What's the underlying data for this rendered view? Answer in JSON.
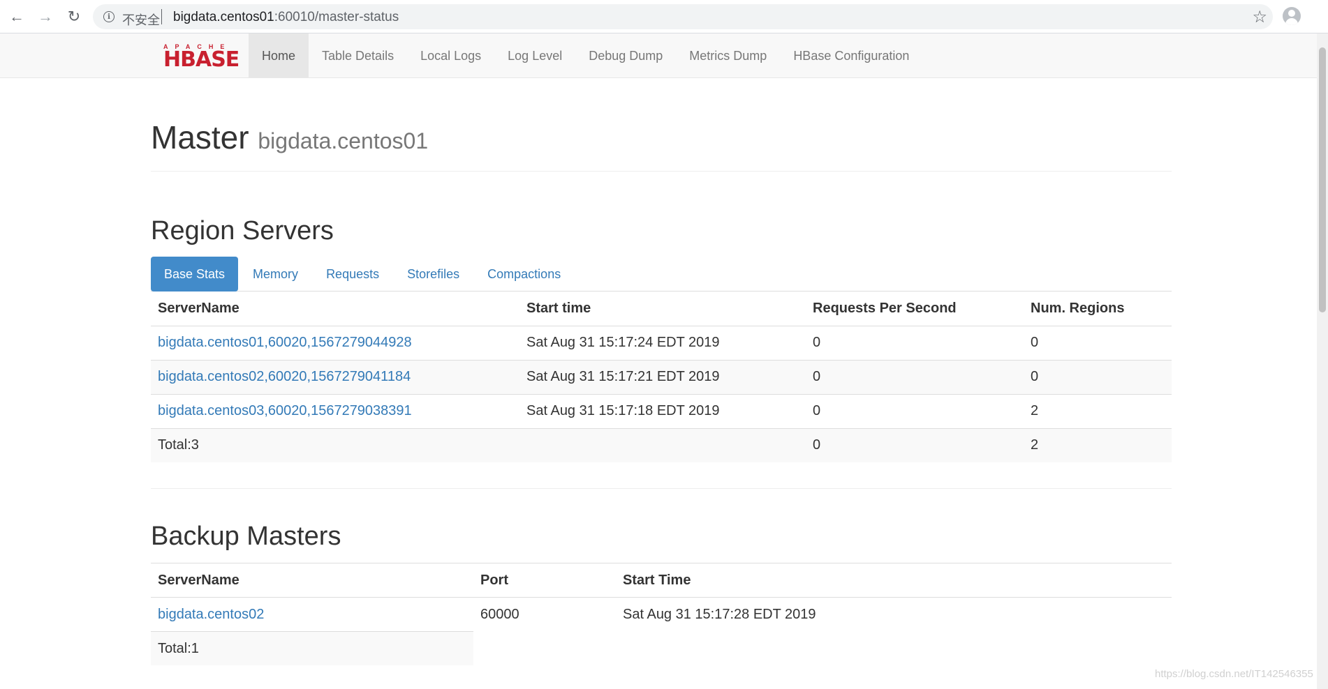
{
  "browser": {
    "insecure_label": "不安全",
    "url_host": "bigdata.centos01",
    "url_rest": ":60010/master-status",
    "icons": {
      "back": "arrow-left-icon",
      "forward": "arrow-right-icon",
      "reload": "reload-icon",
      "info": "info-icon",
      "bookmark": "star-icon",
      "profile": "avatar-icon"
    }
  },
  "navbar": {
    "logo_top": "APACHE",
    "logo_main": "HBASE",
    "items": [
      {
        "label": "Home",
        "active": true
      },
      {
        "label": "Table Details"
      },
      {
        "label": "Local Logs"
      },
      {
        "label": "Log Level"
      },
      {
        "label": "Debug Dump"
      },
      {
        "label": "Metrics Dump"
      },
      {
        "label": "HBase Configuration"
      }
    ]
  },
  "header": {
    "title": "Master",
    "subtitle": "bigdata.centos01"
  },
  "region_servers": {
    "title": "Region Servers",
    "tabs": [
      {
        "label": "Base Stats",
        "active": true
      },
      {
        "label": "Memory"
      },
      {
        "label": "Requests"
      },
      {
        "label": "Storefiles"
      },
      {
        "label": "Compactions"
      }
    ],
    "columns": [
      "ServerName",
      "Start time",
      "Requests Per Second",
      "Num. Regions"
    ],
    "rows": [
      [
        "bigdata.centos01,60020,1567279044928",
        "Sat Aug 31 15:17:24 EDT 2019",
        "0",
        "0"
      ],
      [
        "bigdata.centos02,60020,1567279041184",
        "Sat Aug 31 15:17:21 EDT 2019",
        "0",
        "0"
      ],
      [
        "bigdata.centos03,60020,1567279038391",
        "Sat Aug 31 15:17:18 EDT 2019",
        "0",
        "2"
      ]
    ],
    "total": {
      "label": "Total:3",
      "requests": "0",
      "regions": "2"
    }
  },
  "backup_masters": {
    "title": "Backup Masters",
    "columns": [
      "ServerName",
      "Port",
      "Start Time"
    ],
    "rows": [
      [
        "bigdata.centos02",
        "60000",
        "Sat Aug 31 15:17:28 EDT 2019"
      ]
    ],
    "total": "Total:1"
  },
  "watermark": "https://blog.csdn.net/IT142546355",
  "colors": {
    "link": "#337ab7",
    "active_tab": "#428bca",
    "logo_red": "#c8202f"
  }
}
